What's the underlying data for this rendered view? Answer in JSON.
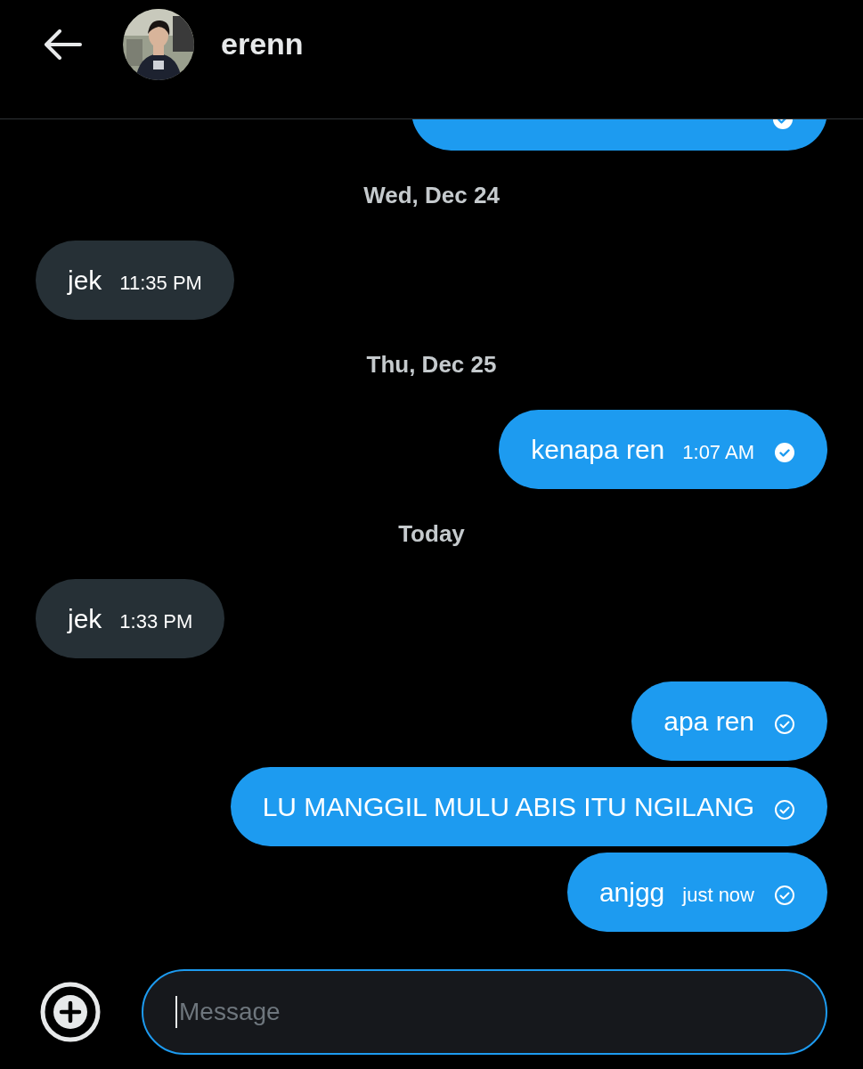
{
  "header": {
    "name": "erenn"
  },
  "messages": [
    {
      "kind": "clipped",
      "read": true
    },
    {
      "kind": "date",
      "text": "Wed, Dec 24"
    },
    {
      "kind": "incoming",
      "text": "jek",
      "time": "11:35 PM"
    },
    {
      "kind": "date",
      "text": "Thu, Dec 25"
    },
    {
      "kind": "outgoing",
      "text": "kenapa ren",
      "time": "1:07 AM",
      "read": true
    },
    {
      "kind": "date",
      "text": "Today"
    },
    {
      "kind": "incoming",
      "text": "jek",
      "time": "1:33 PM"
    },
    {
      "kind": "outgoing",
      "text": "apa ren",
      "read": false
    },
    {
      "kind": "outgoing",
      "text": "LU MANGGIL MULU ABIS ITU NGILANG",
      "read": false
    },
    {
      "kind": "outgoing",
      "text": "anjgg",
      "time": "just now",
      "read": false
    }
  ],
  "composer": {
    "placeholder": "Message"
  }
}
